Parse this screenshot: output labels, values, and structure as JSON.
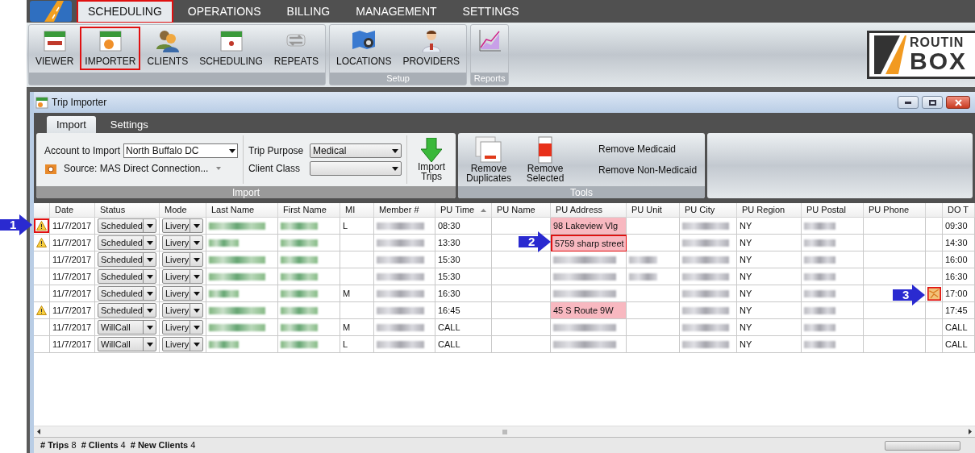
{
  "menu": [
    {
      "label": "SCHEDULING",
      "selected": true,
      "highlighted": true
    },
    {
      "label": "OPERATIONS",
      "selected": false,
      "highlighted": false
    },
    {
      "label": "BILLING",
      "selected": false,
      "highlighted": false
    },
    {
      "label": "MANAGEMENT",
      "selected": false,
      "highlighted": false
    },
    {
      "label": "SETTINGS",
      "selected": false,
      "highlighted": false
    }
  ],
  "ribbon_groups": [
    {
      "buttons": [
        {
          "label": "VIEWER",
          "kind": "calendar",
          "highlighted": false
        },
        {
          "label": "IMPORTER",
          "kind": "import-calendar",
          "highlighted": true
        },
        {
          "label": "CLIENTS",
          "kind": "people",
          "highlighted": false
        },
        {
          "label": "SCHEDULING",
          "kind": "target-calendar",
          "highlighted": false
        },
        {
          "label": "REPEATS",
          "kind": "repeat",
          "highlighted": false
        }
      ]
    },
    {
      "label": "Setup",
      "buttons": [
        {
          "label": "LOCATIONS",
          "kind": "map",
          "highlighted": false
        },
        {
          "label": "PROVIDERS",
          "kind": "doctor",
          "highlighted": false
        }
      ]
    },
    {
      "label": "Reports",
      "buttons": [
        {
          "kind": "chart",
          "highlighted": false
        }
      ]
    }
  ],
  "logo": {
    "line1": "ROUTIN",
    "line2": "BOX"
  },
  "window": {
    "title": "Trip Importer",
    "tabs": [
      {
        "label": "Import",
        "selected": true
      },
      {
        "label": "Settings",
        "selected": false
      }
    ]
  },
  "import_group": {
    "label": "Import",
    "account_label": "Account to Import",
    "account_value": "North Buffalo DC",
    "source": "Source: MAS Direct Connection...",
    "trip_purpose_label": "Trip Purpose",
    "trip_purpose_value": "Medical",
    "client_class_label": "Client Class",
    "import_button": "Import Trips"
  },
  "tools_group": {
    "label": "Tools",
    "buttons": [
      {
        "label": "Remove Duplicates",
        "kind": "duplicates"
      },
      {
        "label": "Remove Selected",
        "kind": "selected"
      }
    ],
    "links": [
      "Remove Medicaid",
      "Remove Non-Medicaid"
    ]
  },
  "grid": {
    "columns": [
      {
        "label": "Date"
      },
      {
        "label": "Status"
      },
      {
        "label": "Mode"
      },
      {
        "label": "Last Name"
      },
      {
        "label": "First Name"
      },
      {
        "label": "MI"
      },
      {
        "label": "Member #"
      },
      {
        "label": "PU Time",
        "sorted": true
      },
      {
        "label": "PU Name"
      },
      {
        "label": "PU Address"
      },
      {
        "label": "PU Unit"
      },
      {
        "label": "PU City"
      },
      {
        "label": "PU Region"
      },
      {
        "label": "PU Postal"
      },
      {
        "label": "PU Phone"
      },
      {
        "label": "DO T"
      }
    ],
    "rows": [
      {
        "warning": true,
        "warning_highlighted": true,
        "date": "11/7/2017",
        "status": "Scheduled",
        "mode": "Livery",
        "mi": "L",
        "pu_time": "08:30",
        "pu_address": "98 Lakeview Vlg",
        "pu_address_invalid": true,
        "pu_address_highlighted": false,
        "pu_unit_blurred": false,
        "pu_region": "NY",
        "map_flag": false,
        "do_time": "09:30"
      },
      {
        "warning": true,
        "warning_highlighted": false,
        "date": "11/7/2017",
        "status": "Scheduled",
        "mode": "Livery",
        "pu_time": "13:30",
        "pu_address": "5759 sharp street",
        "pu_address_invalid": true,
        "pu_address_highlighted": true,
        "pu_unit_blurred": false,
        "pu_region": "NY",
        "map_flag": false,
        "do_time": "14:30"
      },
      {
        "warning": false,
        "warning_highlighted": false,
        "date": "11/7/2017",
        "status": "Scheduled",
        "mode": "Livery",
        "pu_time": "15:30",
        "pu_address_invalid": false,
        "pu_address_highlighted": false,
        "pu_unit_blurred": true,
        "pu_region": "NY",
        "map_flag": false,
        "do_time": "16:00"
      },
      {
        "warning": false,
        "warning_highlighted": false,
        "date": "11/7/2017",
        "status": "Scheduled",
        "mode": "Livery",
        "pu_time": "15:30",
        "pu_address_invalid": false,
        "pu_address_highlighted": false,
        "pu_unit_blurred": true,
        "pu_region": "NY",
        "map_flag": false,
        "do_time": "16:30"
      },
      {
        "warning": false,
        "warning_highlighted": false,
        "date": "11/7/2017",
        "status": "Scheduled",
        "mode": "Livery",
        "mi": "M",
        "pu_time": "16:30",
        "pu_address_invalid": false,
        "pu_address_highlighted": false,
        "pu_unit_blurred": false,
        "pu_region": "NY",
        "map_flag": true,
        "do_time": "17:00"
      },
      {
        "warning": true,
        "warning_highlighted": false,
        "date": "11/7/2017",
        "status": "Scheduled",
        "mode": "Livery",
        "pu_time": "16:45",
        "pu_address": "45 S Route 9W",
        "pu_address_invalid": true,
        "pu_address_highlighted": false,
        "pu_unit_blurred": false,
        "pu_region": "NY",
        "map_flag": false,
        "do_time": "17:45"
      },
      {
        "warning": false,
        "warning_highlighted": false,
        "date": "11/7/2017",
        "status": "WillCall",
        "mode": "Livery",
        "mi": "M",
        "pu_time": "CALL",
        "pu_address_invalid": false,
        "pu_address_highlighted": false,
        "pu_unit_blurred": false,
        "pu_region": "NY",
        "map_flag": false,
        "do_time": "CALL"
      },
      {
        "warning": false,
        "warning_highlighted": false,
        "date": "11/7/2017",
        "status": "WillCall",
        "mode": "Livery",
        "mi": "L",
        "pu_time": "CALL",
        "pu_address_invalid": false,
        "pu_address_highlighted": false,
        "pu_unit_blurred": false,
        "pu_region": "NY",
        "map_flag": false,
        "do_time": "CALL"
      }
    ]
  },
  "status_bar": [
    {
      "label": "# Trips",
      "value": "8"
    },
    {
      "label": "# Clients",
      "value": "4"
    },
    {
      "label": "# New Clients",
      "value": "4"
    }
  ],
  "callouts": [
    {
      "number": "1"
    },
    {
      "number": "2"
    },
    {
      "number": "3"
    }
  ]
}
